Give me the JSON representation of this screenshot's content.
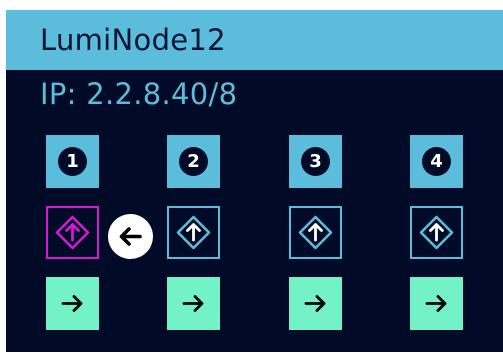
{
  "device": {
    "title": "LumiNode12",
    "ip_label": "IP: 2.2.8.40/8"
  },
  "ports": [
    {
      "number": "1",
      "input_icon": "arrow-up-diamond-icon",
      "output_icon": "arrow-right-icon",
      "selected": true
    },
    {
      "number": "2",
      "input_icon": "arrow-up-diamond-icon",
      "output_icon": "arrow-right-icon",
      "selected": false
    },
    {
      "number": "3",
      "input_icon": "arrow-up-diamond-icon",
      "output_icon": "arrow-right-icon",
      "selected": false
    },
    {
      "number": "4",
      "input_icon": "arrow-up-diamond-icon",
      "output_icon": "arrow-right-icon",
      "selected": false
    }
  ],
  "navigation": {
    "back_icon": "arrow-left-icon"
  },
  "colors": {
    "background": "#010a26",
    "header": "#5cbcdc",
    "selection": "#d21ad2",
    "output": "#72f2c6",
    "white": "#ffffff"
  }
}
